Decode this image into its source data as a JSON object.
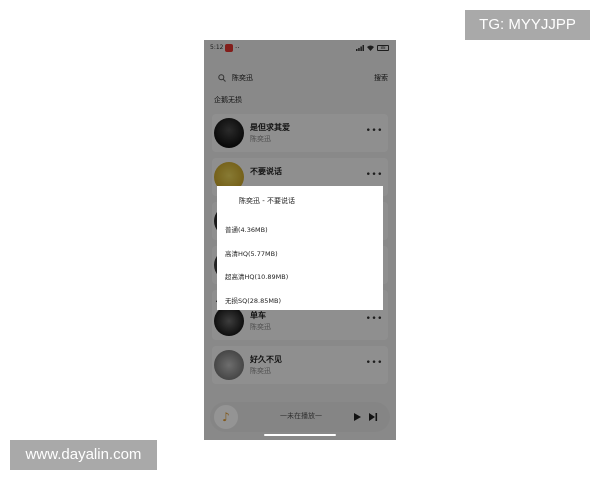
{
  "watermarks": {
    "tg": "TG: MYYJJPP",
    "site": "www.dayalin.com"
  },
  "status_bar": {
    "time": "5:12",
    "dots": "··",
    "battery": "88"
  },
  "search": {
    "query": "陈奕迅",
    "button": "搜索"
  },
  "tabs": [
    {
      "label": "企鹅无损",
      "active": true
    },
    {
      "label": "",
      "active": false
    },
    {
      "label": "",
      "active": false
    },
    {
      "label": "",
      "active": false
    }
  ],
  "songs": [
    {
      "title": "是但求其爱",
      "artist": "陈奕迅"
    },
    {
      "title": "不要说话",
      "artist": ""
    },
    {
      "title": "",
      "artist": ""
    },
    {
      "title": "",
      "artist": ""
    },
    {
      "title": "",
      "artist": ""
    },
    {
      "title": "单车",
      "artist": "陈奕迅"
    },
    {
      "title": "好久不见",
      "artist": "陈奕迅"
    }
  ],
  "dialog": {
    "title": "陈奕迅 - 不要说话",
    "options": [
      "普通(4.36MB)",
      "高清HQ(5.77MB)",
      "超高清HQ(10.89MB)",
      "无损SQ(28.85MB)"
    ]
  },
  "player": {
    "text": "一未在播放一"
  },
  "icons": {
    "search": "magnifier-icon",
    "more": "more-dots-icon",
    "play": "play-icon",
    "next": "next-icon",
    "signal": "signal-icon",
    "wifi": "wifi-icon",
    "battery": "battery-icon"
  },
  "colors": {
    "overlay": "#000000",
    "dialog_bg": "#ffffff",
    "accent_logo": "#e09a2f",
    "status_app_icon": "#e0332e"
  },
  "more_glyph": "•••"
}
